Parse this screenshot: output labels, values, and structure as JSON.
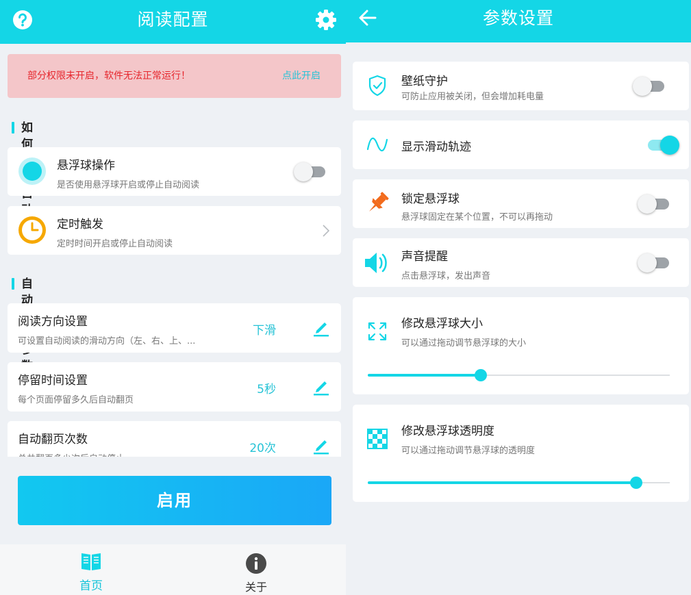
{
  "left": {
    "appbar": {
      "title": "阅读配置",
      "help_icon": "help-circle-icon",
      "settings_icon": "gear-icon"
    },
    "warning": {
      "message": "部分权限未开启，软件无法正常运行！",
      "action": "点此开启"
    },
    "section1": {
      "title": "如何触发自动阅读"
    },
    "float_ball": {
      "title": "悬浮球操作",
      "subtitle": "是否使用悬浮球开启或停止自动阅读",
      "enabled": false
    },
    "timer": {
      "title": "定时触发",
      "subtitle": "定时时间开启或停止自动阅读"
    },
    "section2": {
      "title": "自动阅读参数设置"
    },
    "params": [
      {
        "title": "阅读方向设置",
        "subtitle": "可设置自动阅读的滑动方向（左、右、上、...",
        "value": "下滑"
      },
      {
        "title": "停留时间设置",
        "subtitle": "每个页面停留多久后自动翻页",
        "value": "5秒"
      },
      {
        "title": "自动翻页次数",
        "subtitle": "总共翻页多少次后自动停止",
        "value": "20次"
      }
    ],
    "enable_button": "启用",
    "bottom_nav": [
      {
        "label": "首页",
        "icon": "book-icon",
        "active": true
      },
      {
        "label": "关于",
        "icon": "info-icon",
        "active": false
      }
    ]
  },
  "right": {
    "appbar": {
      "title": "参数设置",
      "back_icon": "back-arrow-icon"
    },
    "settings": [
      {
        "title": "壁纸守护",
        "subtitle": "可防止应用被关闭，但会增加耗电量",
        "icon": "shield-check-icon",
        "enabled": false
      },
      {
        "title": "显示滑动轨迹",
        "subtitle": "",
        "icon": "wave-icon",
        "enabled": true
      },
      {
        "title": "锁定悬浮球",
        "subtitle": "悬浮球固定在某个位置，不可以再拖动",
        "icon": "pin-icon",
        "enabled": false
      },
      {
        "title": "声音提醒",
        "subtitle": "点击悬浮球，发出声音",
        "icon": "speaker-icon",
        "enabled": false
      }
    ],
    "size": {
      "title": "修改悬浮球大小",
      "subtitle": "可以通过拖动调节悬浮球的大小",
      "icon": "expand-arrows-icon",
      "level": 0.375
    },
    "opacity": {
      "title": "修改悬浮球透明度",
      "subtitle": "可以通过拖动调节悬浮球的透明度",
      "icon": "checkerboard-icon",
      "level": 0.89
    }
  },
  "colors": {
    "primary": "#14d6e6",
    "warning_bg": "#f4c6c9",
    "warning_text": "#e6262d",
    "link": "#27c3d6",
    "timer_orange": "#f6a800",
    "pin_orange": "#f26b1d"
  }
}
